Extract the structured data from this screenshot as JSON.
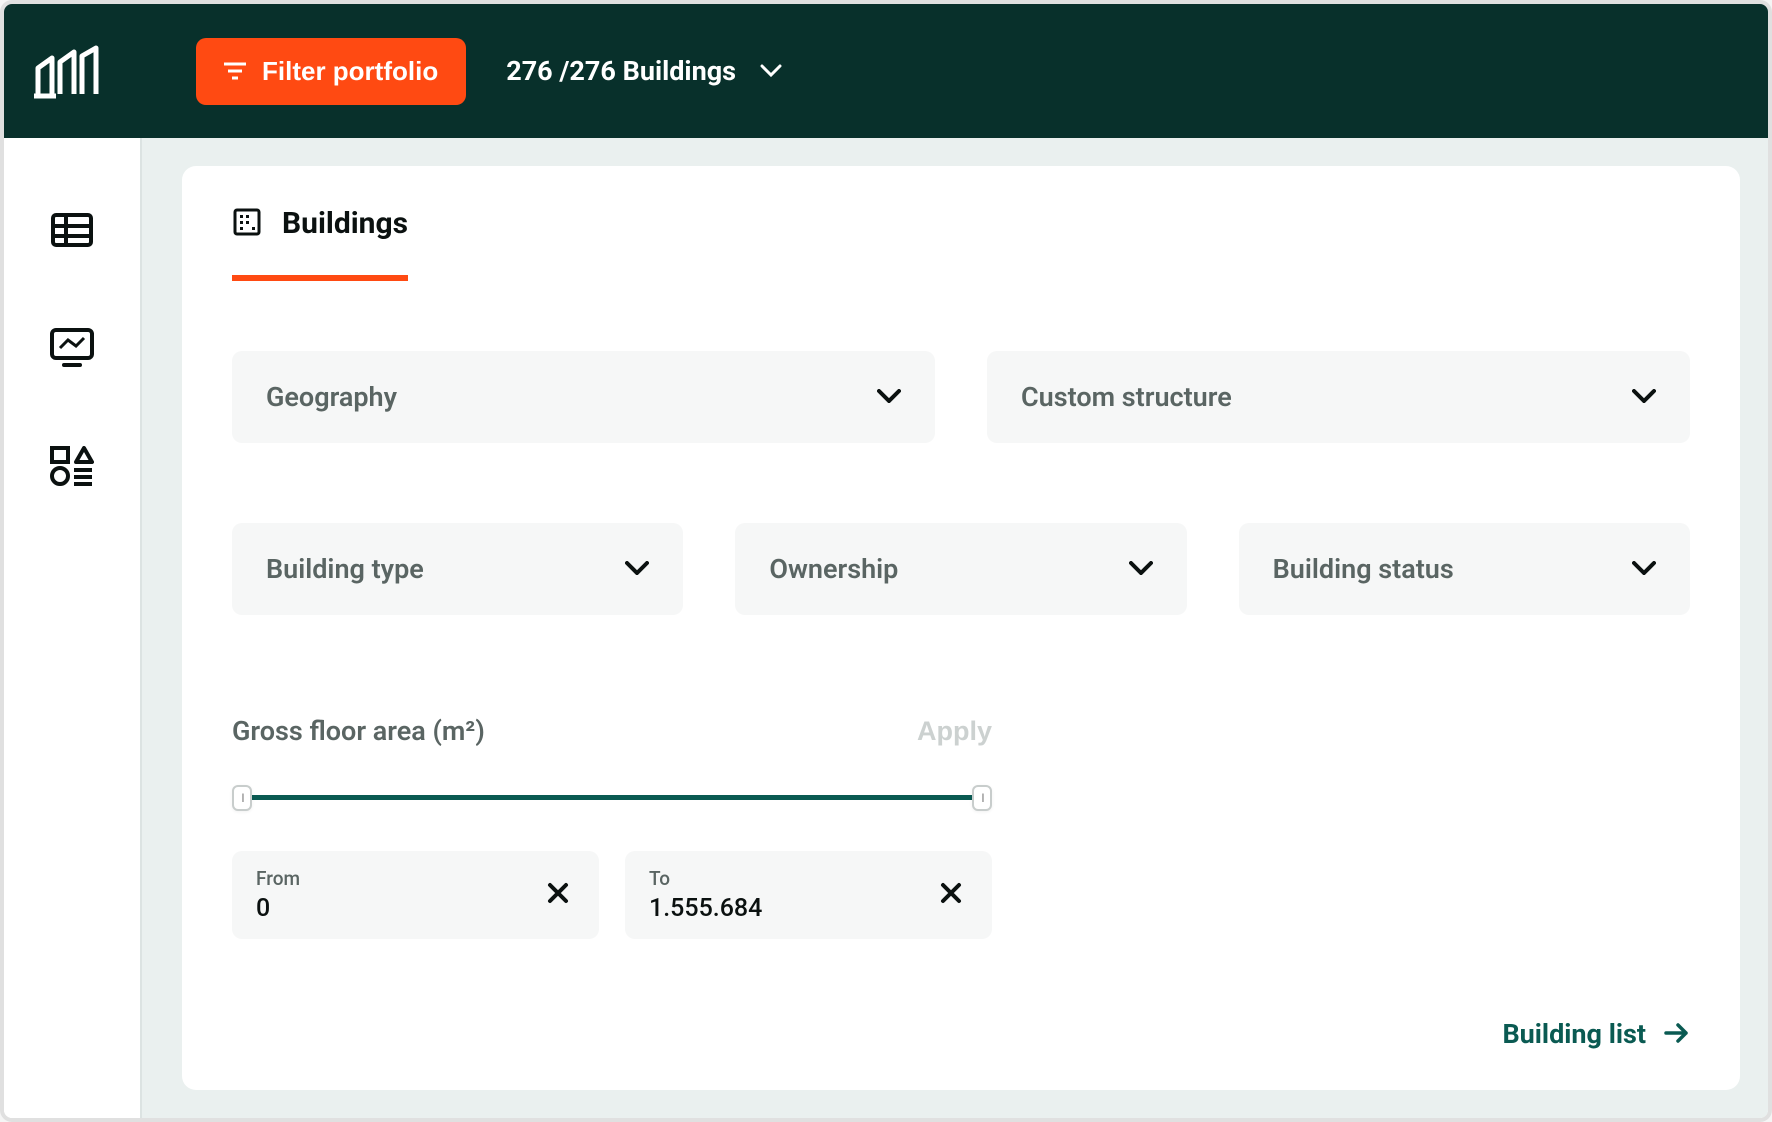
{
  "header": {
    "filter_button": "Filter portfolio",
    "counter": "276 /276 Buildings"
  },
  "tab": {
    "title": "Buildings"
  },
  "selects": {
    "geography": "Geography",
    "custom_structure": "Custom structure",
    "building_type": "Building type",
    "ownership": "Ownership",
    "building_status": "Building status"
  },
  "gfa": {
    "label": "Gross floor area (m²)",
    "apply": "Apply",
    "from_label": "From",
    "from_value": "0",
    "to_label": "To",
    "to_value": "1.555.684"
  },
  "footer": {
    "building_list": "Building list"
  }
}
